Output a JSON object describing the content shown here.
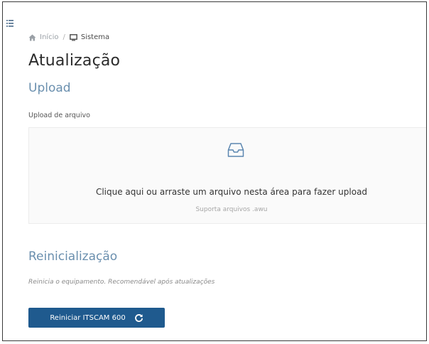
{
  "sidebar": {
    "toggle_icon": "list-menu-icon"
  },
  "breadcrumb": {
    "items": [
      {
        "label": "Início",
        "icon": "home-icon"
      },
      {
        "label": "Sistema",
        "icon": "monitor-icon"
      }
    ],
    "separator": "/"
  },
  "page": {
    "title": "Atualização"
  },
  "upload": {
    "section_title": "Upload",
    "field_label": "Upload de arquivo",
    "dropzone_icon": "inbox-icon",
    "dropzone_text": "Clique aqui ou arraste um arquivo nesta área para fazer upload",
    "dropzone_hint": "Suporta arquivos .awu"
  },
  "reboot": {
    "section_title": "Reinicialização",
    "description": "Reinicia o equipamento. Recomendável após atualizações",
    "button_label": "Reiniciar ITSCAM 600",
    "button_icon": "reload-icon"
  },
  "colors": {
    "accent": "#1f5a8e",
    "section_title": "#6a8fae",
    "icon": "#5b86b0"
  }
}
